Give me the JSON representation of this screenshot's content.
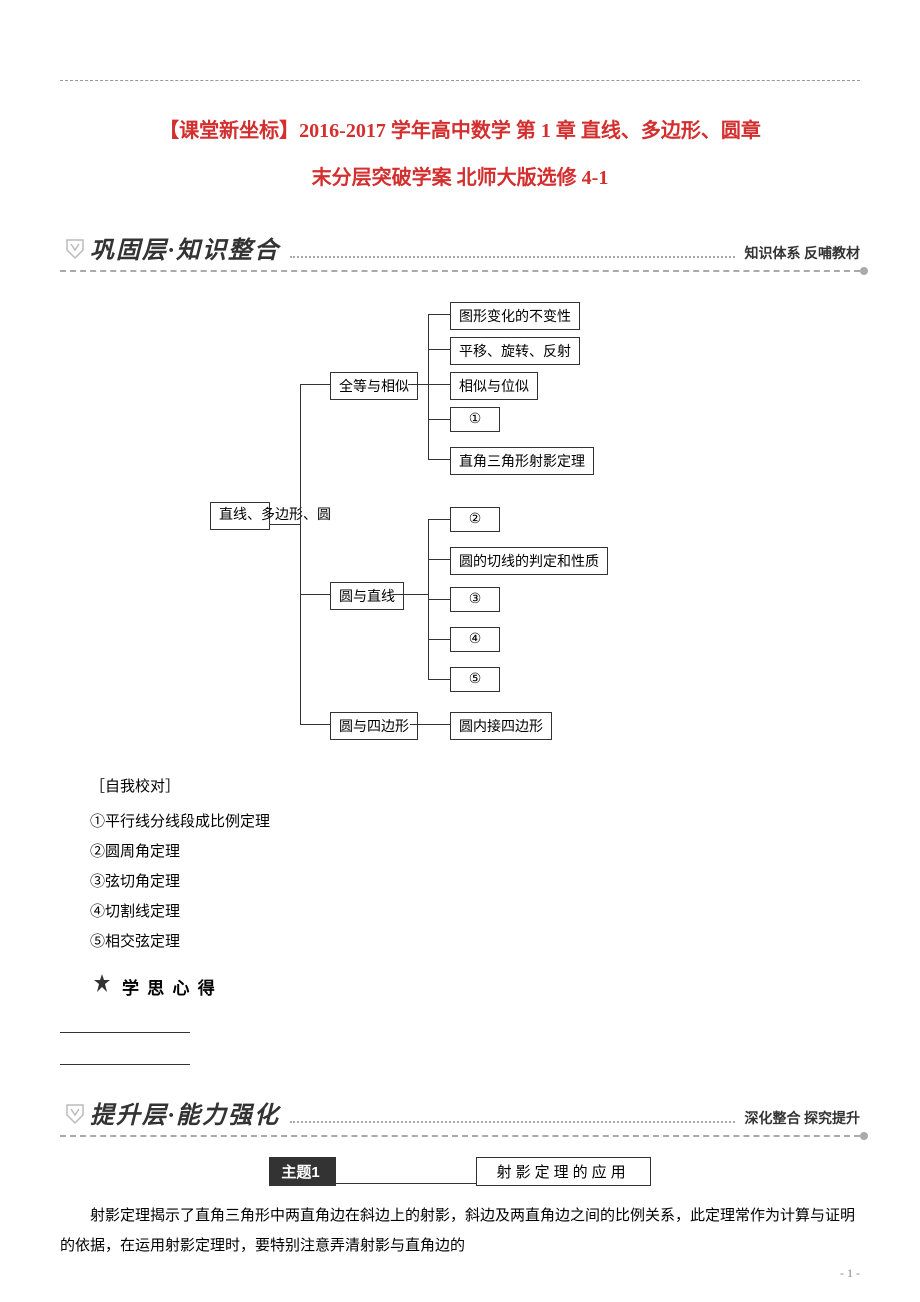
{
  "title": {
    "main": "【课堂新坐标】2016-2017 学年高中数学 第 1 章 直线、多边形、圆章",
    "sub": "末分层突破学案 北师大版选修 4-1"
  },
  "section1": {
    "title": "巩固层·知识整合",
    "right_label": "知识体系  反哺教材"
  },
  "diagram": {
    "root": "直线、多边形、圆",
    "branch1": {
      "name": "全等与相似",
      "items": [
        "图形变化的不变性",
        "平移、旋转、反射",
        "相似与位似",
        "①",
        "直角三角形射影定理"
      ]
    },
    "branch2": {
      "name": "圆与直线",
      "items": [
        "②",
        "圆的切线的判定和性质",
        "③",
        "④",
        "⑤"
      ]
    },
    "branch3": {
      "name": "圆与四边形",
      "items": [
        "圆内接四边形"
      ]
    }
  },
  "answers": {
    "header": "［自我校对］",
    "items": [
      "①平行线分线段成比例定理",
      "②圆周角定理",
      "③弦切角定理",
      "④切割线定理",
      "⑤相交弦定理"
    ]
  },
  "xuesi": "学 思 心 得",
  "section2": {
    "title": "提升层·能力强化",
    "right_label": "深化整合  探究提升"
  },
  "topic": {
    "badge": "主题1",
    "label": "射影定理的应用"
  },
  "body": "射影定理揭示了直角三角形中两直角边在斜边上的射影，斜边及两直角边之间的比例关系，此定理常作为计算与证明的依据，在运用射影定理时，要特别注意弄清射影与直角边的",
  "page": "- 1 -"
}
